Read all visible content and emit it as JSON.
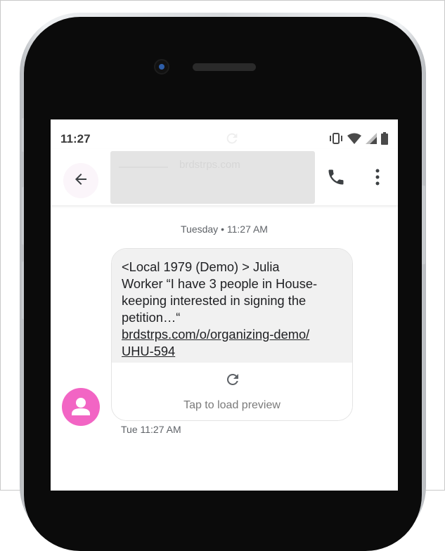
{
  "status_bar": {
    "time": "11:27",
    "icons": [
      "vibrate-icon",
      "wifi-icon",
      "signal-icon",
      "battery-icon"
    ]
  },
  "header": {
    "contact": "brdstrps.com",
    "back_icon": "arrow-back-icon",
    "call_icon": "phone-icon",
    "menu_icon": "more-vert-icon"
  },
  "conversation": {
    "date_separator": "Tuesday • 11:27 AM",
    "message": {
      "text_lines": [
        "<Local 1979 (Demo) > Julia",
        "Worker “I have 3 people in House-",
        "keeping interested in signing the",
        "petition…“"
      ],
      "link_lines": [
        "brdstrps.com/o/organizing-demo/",
        "UHU-594"
      ],
      "preview_label": "Tap to load preview",
      "preview_icon": "refresh-icon",
      "timestamp": "Tue 11:27 AM"
    },
    "avatar_icon": "person-icon"
  },
  "colors": {
    "avatar": "#f265c4",
    "bubble": "#f1f1f1",
    "back_button_bg": "#fbf5fa",
    "phone_bezel": "#0b0b0b"
  }
}
